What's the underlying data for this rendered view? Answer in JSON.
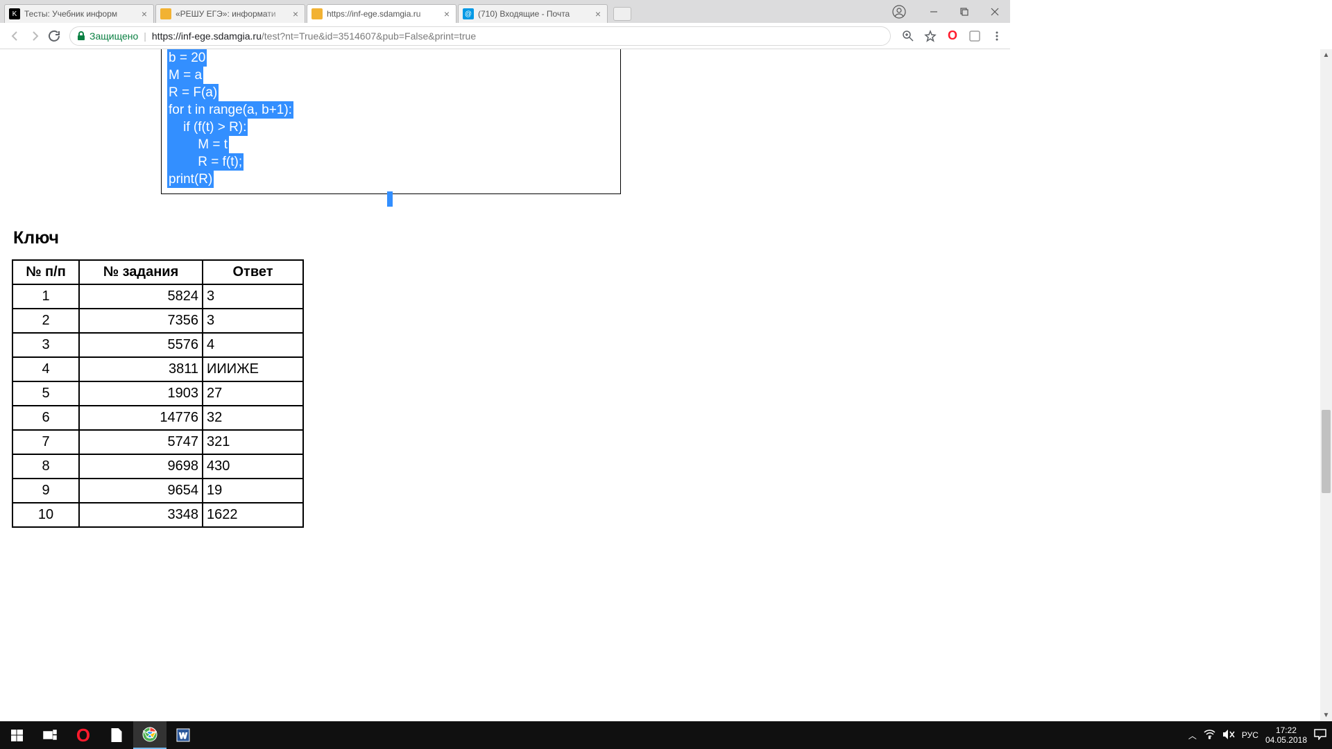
{
  "tabs": [
    {
      "title": "Тесты: Учебник информ",
      "active": false
    },
    {
      "title": "«РЕШУ ЕГЭ»: информати",
      "active": false
    },
    {
      "title": "https://inf-ege.sdamgia.ru",
      "active": true
    },
    {
      "title": "(710) Входящие - Почта",
      "active": false
    }
  ],
  "addressbar": {
    "secure_text": "Защищено",
    "url_host": "https://inf-ege.sdamgia.ru",
    "url_path": "/test?nt=True&id=3514607&pub=False&print=true"
  },
  "code_lines": [
    "b = 20",
    "M = a",
    "R = F(a)",
    "for t in range(a, b+1):",
    "    if (f(t) > R):",
    "        M = t",
    "        R = f(t);",
    "print(R)"
  ],
  "key_heading": "Ключ",
  "key_table": {
    "headers": [
      "№ п/п",
      "№ задания",
      "Ответ"
    ],
    "rows": [
      [
        "1",
        "5824",
        "3"
      ],
      [
        "2",
        "7356",
        "3"
      ],
      [
        "3",
        "5576",
        "4"
      ],
      [
        "4",
        "3811",
        "ИИИЖЕ"
      ],
      [
        "5",
        "1903",
        "27"
      ],
      [
        "6",
        "14776",
        "32"
      ],
      [
        "7",
        "5747",
        "321"
      ],
      [
        "8",
        "9698",
        "430"
      ],
      [
        "9",
        "9654",
        "19"
      ],
      [
        "10",
        "3348",
        "1622"
      ]
    ]
  },
  "tray": {
    "lang": "РУС",
    "time": "17:22",
    "date": "04.05.2018"
  }
}
